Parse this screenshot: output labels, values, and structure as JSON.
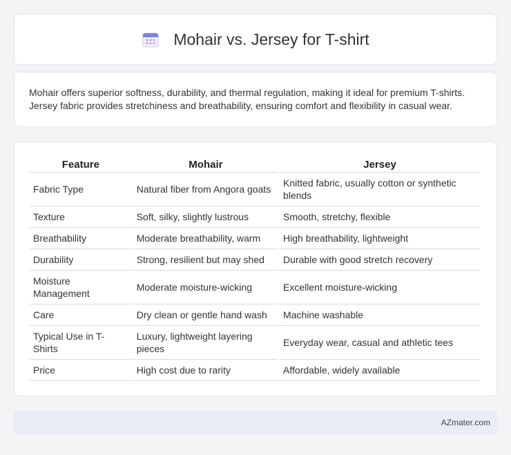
{
  "header": {
    "title": "Mohair vs. Jersey for T-shirt",
    "icon": "calendar-icon"
  },
  "summary": {
    "text": "Mohair offers superior softness, durability, and thermal regulation, making it ideal for premium T-shirts. Jersey fabric provides stretchiness and breathability, ensuring comfort and flexibility in casual wear."
  },
  "table": {
    "headers": [
      "Feature",
      "Mohair",
      "Jersey"
    ],
    "rows": [
      [
        "Fabric Type",
        "Natural fiber from Angora goats",
        "Knitted fabric, usually cotton or synthetic blends"
      ],
      [
        "Texture",
        "Soft, silky, slightly lustrous",
        "Smooth, stretchy, flexible"
      ],
      [
        "Breathability",
        "Moderate breathability, warm",
        "High breathability, lightweight"
      ],
      [
        "Durability",
        "Strong, resilient but may shed",
        "Durable with good stretch recovery"
      ],
      [
        "Moisture Management",
        "Moderate moisture-wicking",
        "Excellent moisture-wicking"
      ],
      [
        "Care",
        "Dry clean or gentle hand wash",
        "Machine washable"
      ],
      [
        "Typical Use in T-Shirts",
        "Luxury, lightweight layering pieces",
        "Everyday wear, casual and athletic tees"
      ],
      [
        "Price",
        "High cost due to rarity",
        "Affordable, widely available"
      ]
    ]
  },
  "footer": {
    "brand": "AZmater.com"
  }
}
